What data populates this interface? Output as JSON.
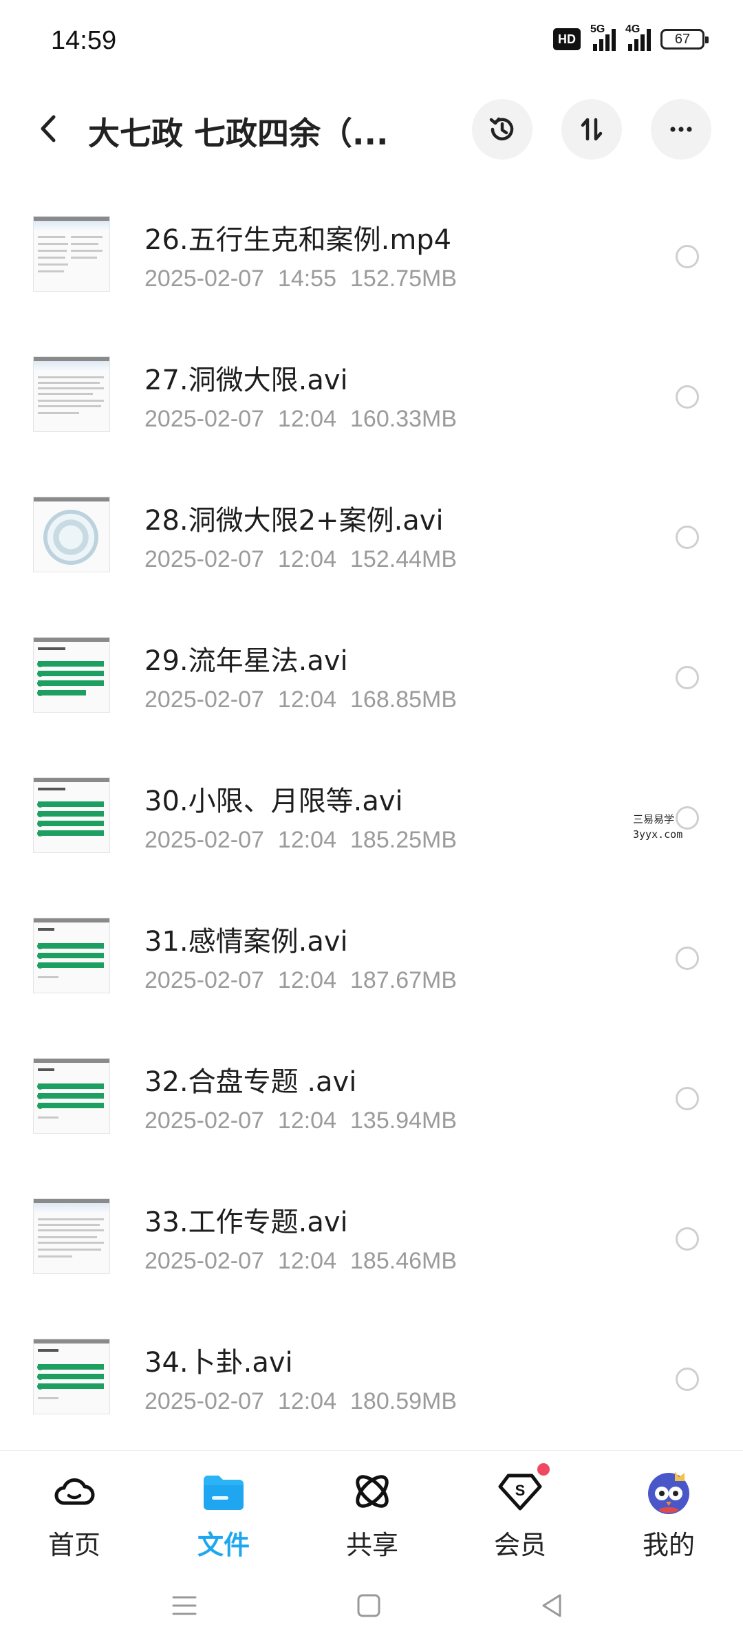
{
  "status_bar": {
    "time": "14:59",
    "hd_label": "HD",
    "net1": "5G",
    "net2": "4G",
    "battery": "67"
  },
  "header": {
    "title": "大七政 七政四余（...",
    "back_icon": "chevron-left-icon",
    "history_icon": "history-icon",
    "sort_icon": "sort-icon",
    "more_icon": "more-icon"
  },
  "files": [
    {
      "name": "26.五行生克和案例.mp4",
      "date": "2025-02-07",
      "time": "14:55",
      "size": "152.75MB",
      "thumb": "text"
    },
    {
      "name": "27.洞微大限.avi",
      "date": "2025-02-07",
      "time": "12:04",
      "size": "160.33MB",
      "thumb": "text"
    },
    {
      "name": "28.洞微大限2+案例.avi",
      "date": "2025-02-07",
      "time": "12:04",
      "size": "152.44MB",
      "thumb": "chart"
    },
    {
      "name": "29.流年星法.avi",
      "date": "2025-02-07",
      "time": "12:04",
      "size": "168.85MB",
      "thumb": "list"
    },
    {
      "name": "30.小限、月限等.avi",
      "date": "2025-02-07",
      "time": "12:04",
      "size": "185.25MB",
      "thumb": "list"
    },
    {
      "name": "31.感情案例.avi",
      "date": "2025-02-07",
      "time": "12:04",
      "size": "187.67MB",
      "thumb": "list"
    },
    {
      "name": "32.合盘专题 .avi",
      "date": "2025-02-07",
      "time": "12:04",
      "size": "135.94MB",
      "thumb": "list"
    },
    {
      "name": "33.工作专题.avi",
      "date": "2025-02-07",
      "time": "12:04",
      "size": "185.46MB",
      "thumb": "text"
    },
    {
      "name": "34.卜卦.avi",
      "date": "2025-02-07",
      "time": "12:04",
      "size": "180.59MB",
      "thumb": "list"
    }
  ],
  "watermark": {
    "line1": "三易易学",
    "line2": "3yyx.com"
  },
  "bottom_nav": [
    {
      "label": "首页",
      "icon": "home-cloud-icon",
      "active": false
    },
    {
      "label": "文件",
      "icon": "folder-icon",
      "active": true
    },
    {
      "label": "共享",
      "icon": "share-icon",
      "active": false
    },
    {
      "label": "会员",
      "icon": "vip-icon",
      "active": false
    },
    {
      "label": "我的",
      "icon": "avatar-icon",
      "active": false
    }
  ],
  "colors": {
    "accent": "#1ea7f0",
    "muted": "#9b9b9b",
    "thumb_green": "#1e9f62",
    "badge": "#f04860"
  }
}
